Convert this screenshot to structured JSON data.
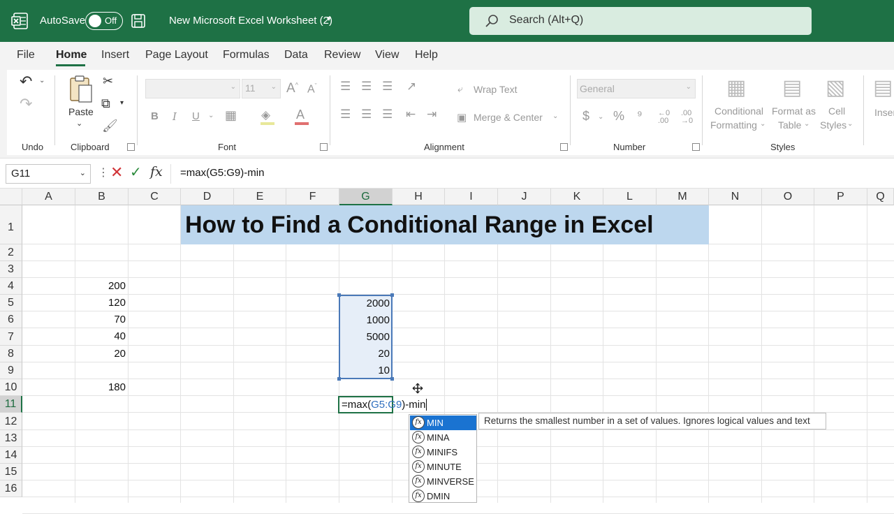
{
  "titlebar": {
    "autosave_label": "AutoSave",
    "toggle_state": "Off",
    "document_name": "New Microsoft Excel Worksheet (2)",
    "search_placeholder": "Search (Alt+Q)",
    "accent_color": "#1e7145"
  },
  "tabs": [
    "File",
    "Home",
    "Insert",
    "Page Layout",
    "Formulas",
    "Data",
    "Review",
    "View",
    "Help"
  ],
  "active_tab": "Home",
  "ribbon": {
    "undo_group": "Undo",
    "clipboard_group": "Clipboard",
    "paste_label": "Paste",
    "font_group": "Font",
    "font_size": "11",
    "alignment_group": "Alignment",
    "wrap_text": "Wrap Text",
    "merge_center": "Merge & Center",
    "number_group": "Number",
    "number_format": "General",
    "styles_group": "Styles",
    "conditional_formatting": [
      "Conditional",
      "Formatting"
    ],
    "format_as_table": [
      "Format as",
      "Table"
    ],
    "cell_styles": [
      "Cell",
      "Styles"
    ],
    "insert_partial": "Inser"
  },
  "formula_bar": {
    "name_box": "G11",
    "formula": "=max(G5:G9)-min"
  },
  "sheet": {
    "columns": [
      "A",
      "B",
      "C",
      "D",
      "E",
      "F",
      "G",
      "H",
      "I",
      "J",
      "K",
      "L",
      "M",
      "N",
      "O",
      "P",
      "Q"
    ],
    "rows": [
      "1",
      "2",
      "3",
      "4",
      "5",
      "6",
      "7",
      "8",
      "9",
      "10",
      "11",
      "12",
      "13",
      "14",
      "15",
      "16"
    ],
    "title": "How to Find a Conditional Range in Excel",
    "column_b": {
      "4": "200",
      "5": "120",
      "6": "70",
      "7": "40",
      "8": "20",
      "10": "180"
    },
    "column_g": {
      "5": "2000",
      "6": "1000",
      "7": "5000",
      "8": "20",
      "9": "10"
    },
    "active_cell": {
      "before": "=max(",
      "ref": "G5:G9",
      "after": ")-min"
    }
  },
  "autocomplete": {
    "items": [
      "MIN",
      "MINA",
      "MINIFS",
      "MINUTE",
      "MINVERSE",
      "DMIN"
    ],
    "selected": "MIN",
    "tooltip": "Returns the smallest number in a set of values. Ignores logical values and text"
  }
}
